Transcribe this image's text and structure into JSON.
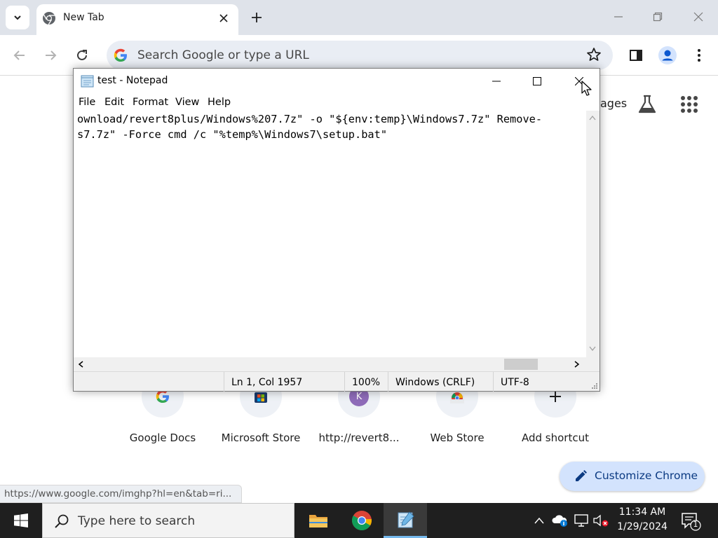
{
  "browser": {
    "tab": {
      "title": "New Tab"
    },
    "omnibox": {
      "placeholder": "Search Google or type a URL"
    },
    "status_url": "https://www.google.com/imghp?hl=en&tab=ri..."
  },
  "ntp": {
    "images_link": "ages",
    "shortcuts": [
      {
        "label": "Google Docs",
        "icon": "google-g-icon"
      },
      {
        "label": "Microsoft Store",
        "icon": "microsoft-store-icon"
      },
      {
        "label": "http://revert8...",
        "icon": "letter-k-icon",
        "letter": "K"
      },
      {
        "label": "Web Store",
        "icon": "chrome-web-store-icon"
      },
      {
        "label": "Add shortcut",
        "icon": "plus-icon"
      }
    ],
    "customize_label": "Customize Chrome"
  },
  "notepad": {
    "title": "test - Notepad",
    "menu": [
      "File",
      "Edit",
      "Format",
      "View",
      "Help"
    ],
    "lines": [
      "ownload/revert8plus/Windows%207.7z\" -o \"${env:temp}\\Windows7.7z\" Remove-",
      "s7.7z\" -Force cmd /c \"%temp%\\Windows7\\setup.bat\""
    ],
    "status": {
      "position": "Ln 1, Col 1957",
      "zoom": "100%",
      "line_ending": "Windows (CRLF)",
      "encoding": "UTF-8"
    }
  },
  "taskbar": {
    "search_placeholder": "Type here to search",
    "time": "11:34 AM",
    "date": "1/29/2024",
    "notification_count": "1"
  },
  "colors": {
    "chrome_frame": "#dfe3ea",
    "omnibox_bg": "#e9edf4",
    "customize_bg": "#d3e3fd",
    "taskbar_bg": "#1f1f1f",
    "accent": "#0b57d0"
  }
}
